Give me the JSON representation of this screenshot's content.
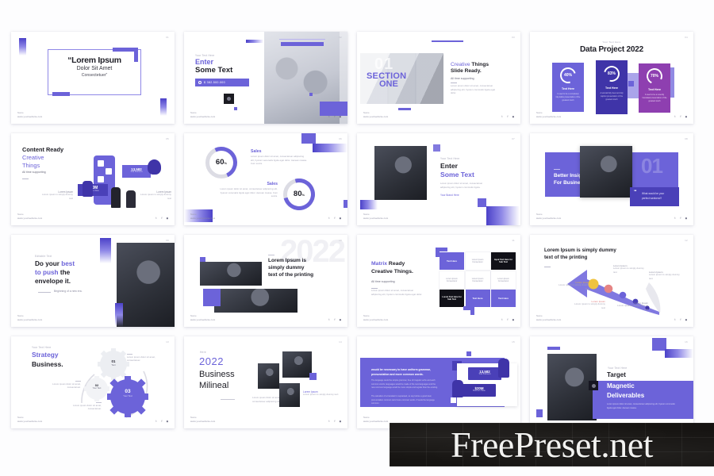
{
  "watermark": {
    "text": "FreePreset.net"
  },
  "common": {
    "footer_label": "Name",
    "footer_url": "www.yourwebsite.com",
    "social_icons": [
      "twitter-icon",
      "facebook-icon",
      "instagram-icon"
    ]
  },
  "slides": [
    {
      "id": "slide-1-title",
      "page": "01",
      "title_line1": "“Lorem Ipsum",
      "title_line2": "Dolor Sit Amet",
      "title_line3": "Consectetuer”"
    },
    {
      "id": "slide-2-enter-some-text",
      "page": "02",
      "eyebrow": "Your Text Here",
      "title_line1": "Enter",
      "title_line2": "Some Text",
      "button_label": "$ 382.500.000"
    },
    {
      "id": "slide-3-section-one",
      "page": "03",
      "overlay_number": "01",
      "overlay_line1": "SECTION",
      "overlay_line2": "ONE",
      "title_line1_accent": "Creative",
      "title_line1_rest": "Things",
      "title_line2": "Slide Ready.",
      "subtitle": "All time supporting",
      "body": "Lorem ipsum dolor sit amet, consectetuer adipiscing elit, hyeium commodo ligula eget dolor."
    },
    {
      "id": "slide-4-data-project",
      "page": "04",
      "eyebrow": "Your Text Here",
      "title": "Data Project 2022",
      "cards": [
        {
          "percent": "40%",
          "heading": "Text Here",
          "body": "It used to be a completely tidy-kable presentation of the greatest touch",
          "color": "#6c63d9"
        },
        {
          "percent": "83%",
          "heading": "Text Here",
          "body": "A wonderfully clear and tidy caption presentation of the greatest touch",
          "color": "#3f34a8"
        },
        {
          "percent": "70%",
          "heading": "Text Here",
          "body": "It used to be a recently translated presentation of the greatest touch",
          "color": "#8e3fb0"
        }
      ]
    },
    {
      "id": "slide-5-content-ready",
      "page": "05",
      "title_line1": "Content Ready",
      "title_line2_accent": "Creative",
      "title_line3_accent": "Things",
      "subtitle": "All time supporting",
      "stat_money": "$20M",
      "stat_money_label": "Business Value",
      "stat_count": "13,582",
      "stat_count_label": "Total Followers",
      "note_left_title": "Lorem Ipsum",
      "note_left_body": "Lorem ipsum is simply dummy text",
      "note_right_title": "Lorem Ipsum",
      "note_right_body": "Lorem ipsum is simply dummy text"
    },
    {
      "id": "slide-6-sales-donuts",
      "page": "06",
      "donut_1_value": "60",
      "donut_1_unit": "%",
      "donut_2_value": "80",
      "donut_2_unit": "%",
      "heading_1": "Sales",
      "body_1": "Lorem ipsum dolor sit amet, consectetuer adipiscing elit, hyeium venenatis ligula eget dolor. Aenean massa. Cum sociis.",
      "heading_2": "Sales",
      "body_2": "Lorem ipsum dolor sit amet, consectetuer adipiscing elit, hyeium venenatis ligula eget dolor. Aenean massa. Cum sociis."
    },
    {
      "id": "slide-7-enter-some-text-photo",
      "page": "07",
      "eyebrow": "Your Text Here",
      "title_line1": "Enter",
      "title_line2_accent": "Some Text",
      "body": "Lorem ipsum dolor sit amet, consectetuer adipiscing elit, hyeium commodo ligula.",
      "link_label": "Your Brand Here"
    },
    {
      "id": "slide-8-better-insight",
      "page": "08",
      "overlay_number": "01",
      "title_line1": "Better Insight",
      "title_line2": "For Business",
      "quote_mark": "“",
      "quote_line1": "What would be your",
      "quote_line2": "perfect weekend?"
    },
    {
      "id": "slide-9-do-your-best",
      "page": "09",
      "eyebrow": "Editable Text",
      "title_line1_a": "Do your",
      "title_line1_b": "best",
      "title_line2_a": "to push",
      "title_line2_b": "the",
      "title_line3": "envelope it.",
      "caption": "Beginning of a new era."
    },
    {
      "id": "slide-10-lorem-ipsum-printing",
      "page": "10",
      "ghost_number": "2022",
      "title_line1": "Lorem Ipsum is",
      "title_line2": "simply dummy",
      "title_line3": "text of the printing"
    },
    {
      "id": "slide-11-matrix-ready",
      "page": "11",
      "title_line1_accent": "Matrix",
      "title_line1_rest": "Ready",
      "title_line2": "Creative Things.",
      "subtitle": "All time supporting",
      "body": "Lorem ipsum dolor sit amet, consectetuer adipiscing elit, hyeium commodo ligula eget dolor.",
      "cells": [
        {
          "label": "Text Here",
          "style": "purple"
        },
        {
          "label": "Lorem Ipsum Consectetur",
          "style": "white"
        },
        {
          "label": "Input Text Here for Sub Text",
          "style": "black"
        },
        {
          "label": "Lorem Ipsum Consectetur",
          "style": "white"
        },
        {
          "label": "Lorem Ipsum Consectetur",
          "style": "white"
        },
        {
          "label": "Lorem Ipsum Consectetur",
          "style": "white"
        },
        {
          "label": "Lorem Text Here for Sub Text",
          "style": "black"
        },
        {
          "label": "Text Here",
          "style": "purple"
        },
        {
          "label": "Text Here",
          "style": "purple"
        }
      ]
    },
    {
      "id": "slide-12-arrow-diagram",
      "page": "12",
      "title_line1": "Lorem Ipsum is simply dummy",
      "title_line2": "text of the printing",
      "labels": [
        {
          "title": "Lorem Ipsum",
          "body": "Lorem ipsum is simply dummy text",
          "color": "#e0b23f"
        },
        {
          "title": "Lorem Ipsum",
          "body": "Lorem ipsum is simply dummy text",
          "color": "#e07a7a"
        },
        {
          "title": "Lorem Ipsum",
          "body": "Lorem ipsum is simply dummy text",
          "color": "#8b8ba0"
        },
        {
          "title": "Lorem Ipsum",
          "body": "Lorem ipsum is simply dummy text",
          "color": "#8b8ba0"
        },
        {
          "title": "Lorem Ipsum",
          "body": "Lorem ipsum is simply dummy text",
          "color": "#8b8ba0"
        }
      ]
    },
    {
      "id": "slide-13-strategy-business",
      "page": "13",
      "eyebrow": "Your Text Here",
      "title_line1_accent": "Strategy",
      "title_line2": "Business.",
      "gears": [
        {
          "number": "01",
          "label": "Text"
        },
        {
          "number": "02",
          "label": "Your Text"
        },
        {
          "number": "03",
          "label": "Your Text"
        }
      ],
      "notes": [
        "Lorem ipsum dolor sit amet, consectetuer.",
        "Lorem ipsum dolor sit amet, consectetuer.",
        "Lorem ipsum dolor sit amet, consectetuer."
      ]
    },
    {
      "id": "slide-14-2022-business-milineal",
      "page": "14",
      "eyebrow": "Here",
      "title_number": "2022",
      "title_line1": "Business",
      "title_line2": "Milineal",
      "caption_line1": "Lorem ipsum dolor sit amet,",
      "caption_line2": "consectetuer adipiscing elit.",
      "note_title": "Lorem Ipsum",
      "note_body": "Lorem ipsum is simply dummy text"
    },
    {
      "id": "slide-15-uniform-grammar",
      "page": "15",
      "heading_line1": "would be necessary to have uniform grammar,",
      "heading_line2": "pronunciation and more common words.",
      "body_1": "The language would be simple grammar, free of irregular verbs and each common words, languages would be made of the new languages and the new common language would be more simple and regular than the existing.",
      "body_2": "The salvation of a translator is separated, so say before a good deal, pronunciation common word more common words. If would be language common.",
      "stat_count": "13,582",
      "stat_count_label": "Total Followers",
      "stat_money": "$20M",
      "stat_money_label": "Business Value"
    },
    {
      "id": "slide-16-target-magnetic",
      "page": "16",
      "eyebrow": "Your Text Here",
      "title_line1": "Target",
      "title_line2": "Magnetic",
      "title_line3": "Deliverables",
      "body": "Lorem ipsum dolor sit amet, consectetuer adipiscing elit, hyeium commodo ligula eget dolor. Aenean massa."
    }
  ]
}
